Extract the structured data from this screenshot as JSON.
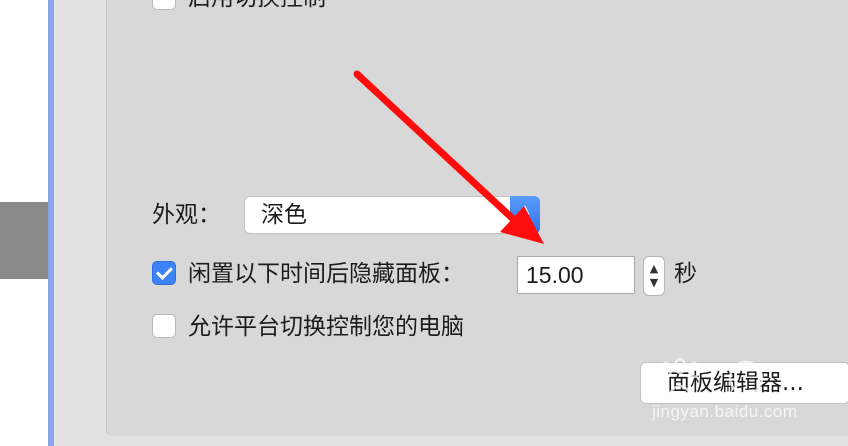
{
  "top_checkbox": {
    "label": "启用切换控制",
    "checked": false
  },
  "appearance": {
    "label": "外观：",
    "value": "深色"
  },
  "hide_panel": {
    "label": "闲置以下时间后隐藏面板：",
    "checked": true,
    "seconds": "15.00",
    "unit": "秒"
  },
  "allow_platform": {
    "label": "允许平台切换控制您的电脑",
    "checked": false
  },
  "panel_editor_button": {
    "label": "面板编辑器..."
  },
  "watermark": {
    "text": "jingyan.baidu.com"
  },
  "icons": [
    "up-down-chevron-icon",
    "stepper-up-icon",
    "stepper-down-icon",
    "annotation-arrow"
  ],
  "colors": {
    "accent": "#3d82f7",
    "sidebar": "#8aa6e6",
    "annotation": "#ff0d0d"
  }
}
